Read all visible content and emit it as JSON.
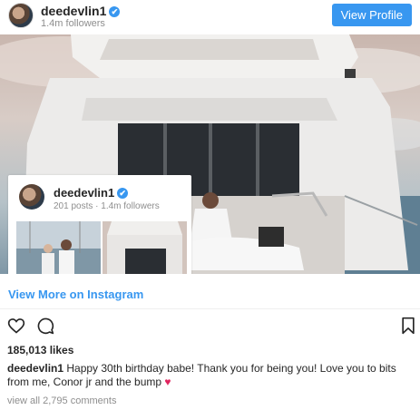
{
  "header": {
    "username": "deedevlin1",
    "verified_glyph": "✔",
    "followers": "1.4m followers",
    "view_profile_label": "View Profile"
  },
  "media": {
    "description_icon": "yacht-photo"
  },
  "card": {
    "username": "deedevlin1",
    "verified_glyph": "✔",
    "stats": "201 posts · 1.4m followers"
  },
  "view_more_label": "View More on Instagram",
  "actions": {
    "like_icon": "heart-icon",
    "comment_icon": "comment-icon",
    "save_icon": "bookmark-icon"
  },
  "likes": "185,013 likes",
  "caption": {
    "username": "deedevlin1",
    "text": " Happy 30th birthday babe! Thank you for being you! Love you to bits from me, Conor jr and the bump ",
    "emoji": "♥"
  },
  "view_comments": "view all 2,795 comments",
  "colors": {
    "accent": "#3897f0",
    "text": "#262626",
    "muted": "#8e8e8e",
    "heart": "#e0245e"
  }
}
